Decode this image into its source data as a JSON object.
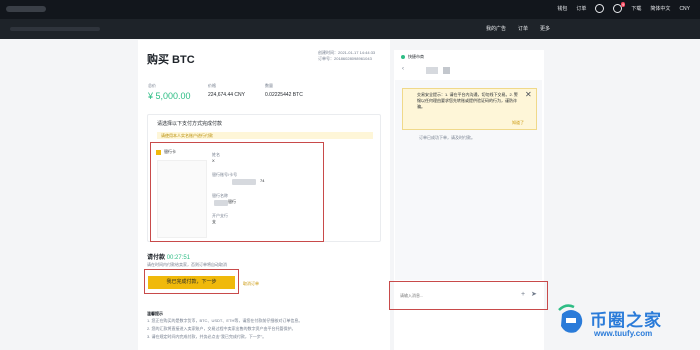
{
  "nav": {
    "items": [
      "钱包",
      "订单",
      "",
      "",
      "下载",
      "简体中文",
      "CNY"
    ],
    "notif_count": "9"
  },
  "subnav": {
    "items": [
      "我的广告",
      "订单",
      "更多"
    ]
  },
  "page": {
    "title": "购买 BTC",
    "created_label": "创建时间：2021-01-17 14:44:33",
    "order_no": "订单号：20186028098961043"
  },
  "stats": {
    "amount_label": "总价",
    "amount_value": "¥ 5,000.00",
    "price_label": "价格",
    "price_value": "224,674.44 CNY",
    "qty_label": "数量",
    "qty_value": "0.02225442 BTC"
  },
  "payment": {
    "section_title": "请选择以下支付方式完成付款",
    "notice": "请使用本人实名账户进行付款",
    "method": "银行卡",
    "fields": [
      {
        "label": "姓名",
        "value": "X"
      },
      {
        "label": "银行账号/卡号",
        "value": "74"
      },
      {
        "label": "银行名称",
        "value": "银行"
      },
      {
        "label": "开户支行",
        "value": "支"
      }
    ]
  },
  "pay": {
    "title": "请付款",
    "timer": "00:27:51",
    "hint": "请在时间内付款给卖家，否则订单将自动取消",
    "button": "我已完成付款，下一步",
    "cancel": "取消订单"
  },
  "notes": {
    "title": "温馨提示",
    "items": [
      "1. 您正在购买的是数字货币，BTC、USDT、ETH等，请您在付款前仔细核对订单信息。",
      "2. 您的汇款将直接进入卖家账户，交易过程中卖家出售的数字资产由平台托管保护。",
      "3. 请在规定时间内完成付款，并务必点击\"我已完成付款，下一步\"。"
    ]
  },
  "chat": {
    "header": "快捷市商",
    "warning": "交易安全提示：1. 请在平台内沟通，切勿线下交易。2. 警惕以任何理由要求您先转账或提供验证码的行为，谨防诈骗。",
    "warning_ok": "知道了",
    "system_msg": "订单已成功下单，请及时付款。",
    "input_placeholder": "请输入消息..."
  },
  "watermark": {
    "title": "币圈之家",
    "url": "www.tuufy.com"
  },
  "colors": {
    "accent": "#f0b90b",
    "green": "#2ebd85",
    "highlight": "#c84a4a",
    "watermark": "#2a7bd9"
  }
}
